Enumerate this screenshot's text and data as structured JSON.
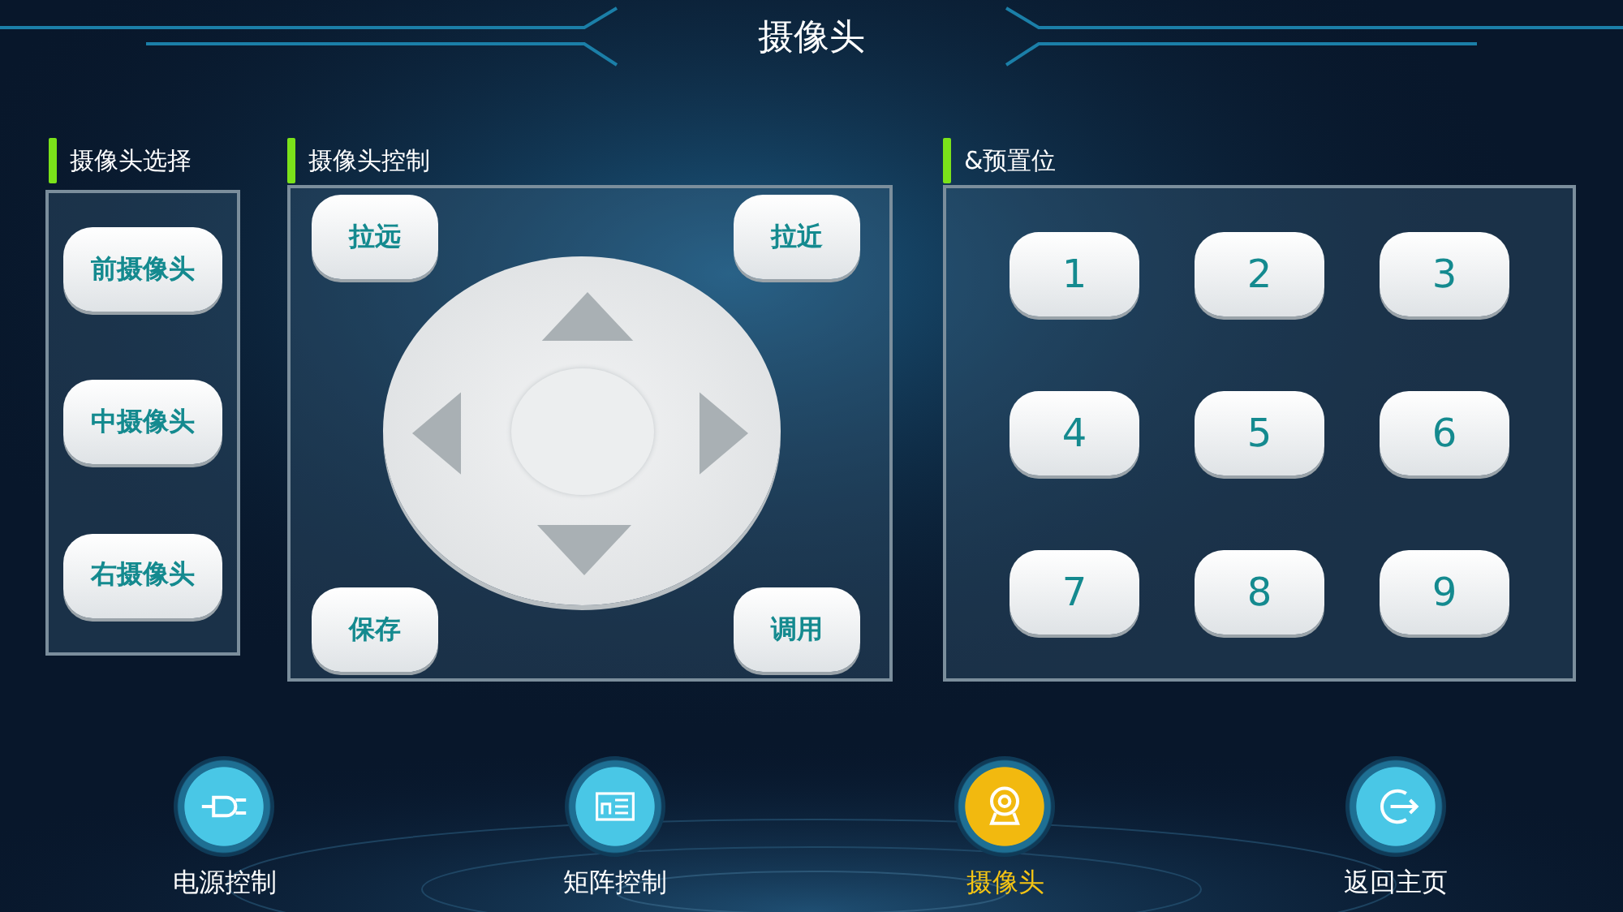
{
  "header": {
    "title": "摄像头"
  },
  "camera_select": {
    "title": "摄像头选择",
    "buttons": [
      "前摄像头",
      "中摄像头",
      "右摄像头"
    ]
  },
  "camera_control": {
    "title": "摄像头控制",
    "buttons": [
      {
        "label": "拉远",
        "kind": "top-left"
      },
      {
        "label": "拉近",
        "kind": "top-right"
      },
      {
        "label": "保存",
        "kind": "bottom-left"
      },
      {
        "label": "调用",
        "kind": "bottom-right"
      }
    ]
  },
  "presets": {
    "title": "&预置位",
    "buttons": [
      "1",
      "2",
      "3",
      "4",
      "5",
      "6",
      "7",
      "8",
      "9"
    ]
  },
  "nav": [
    {
      "label": "电源控制",
      "kind": "plug",
      "selected": false
    },
    {
      "label": "矩阵控制",
      "kind": "rack",
      "selected": false
    },
    {
      "label": "摄像头",
      "kind": "webcam",
      "selected": true
    },
    {
      "label": "返回主页",
      "kind": "exit",
      "selected": false
    }
  ]
}
